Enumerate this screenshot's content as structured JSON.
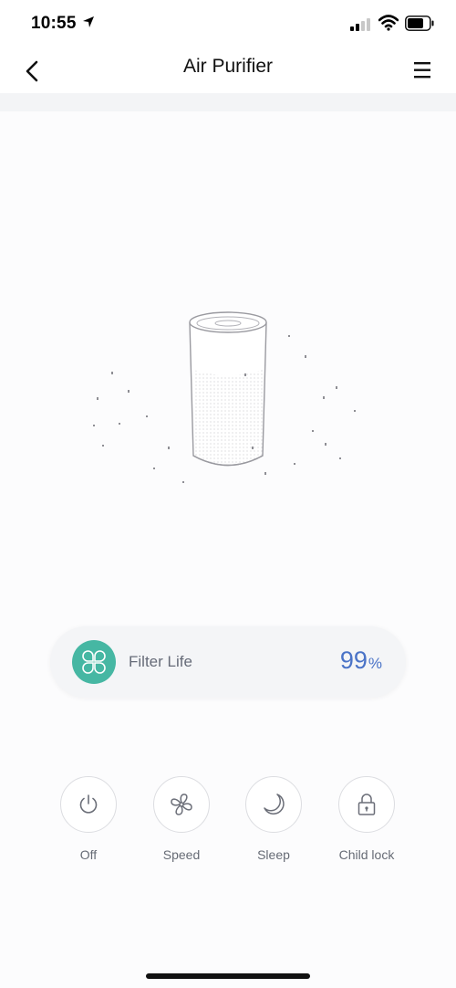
{
  "status_bar": {
    "time": "10:55"
  },
  "header": {
    "title": "Air Purifier"
  },
  "filter": {
    "label": "Filter Life",
    "value": "99",
    "unit": "%",
    "accent_color": "#46b7a3",
    "value_color": "#4a73c7"
  },
  "controls": [
    {
      "label": "Off",
      "icon": "power-icon"
    },
    {
      "label": "Speed",
      "icon": "fan-icon"
    },
    {
      "label": "Sleep",
      "icon": "moon-icon"
    },
    {
      "label": "Child lock",
      "icon": "lock-icon"
    }
  ]
}
